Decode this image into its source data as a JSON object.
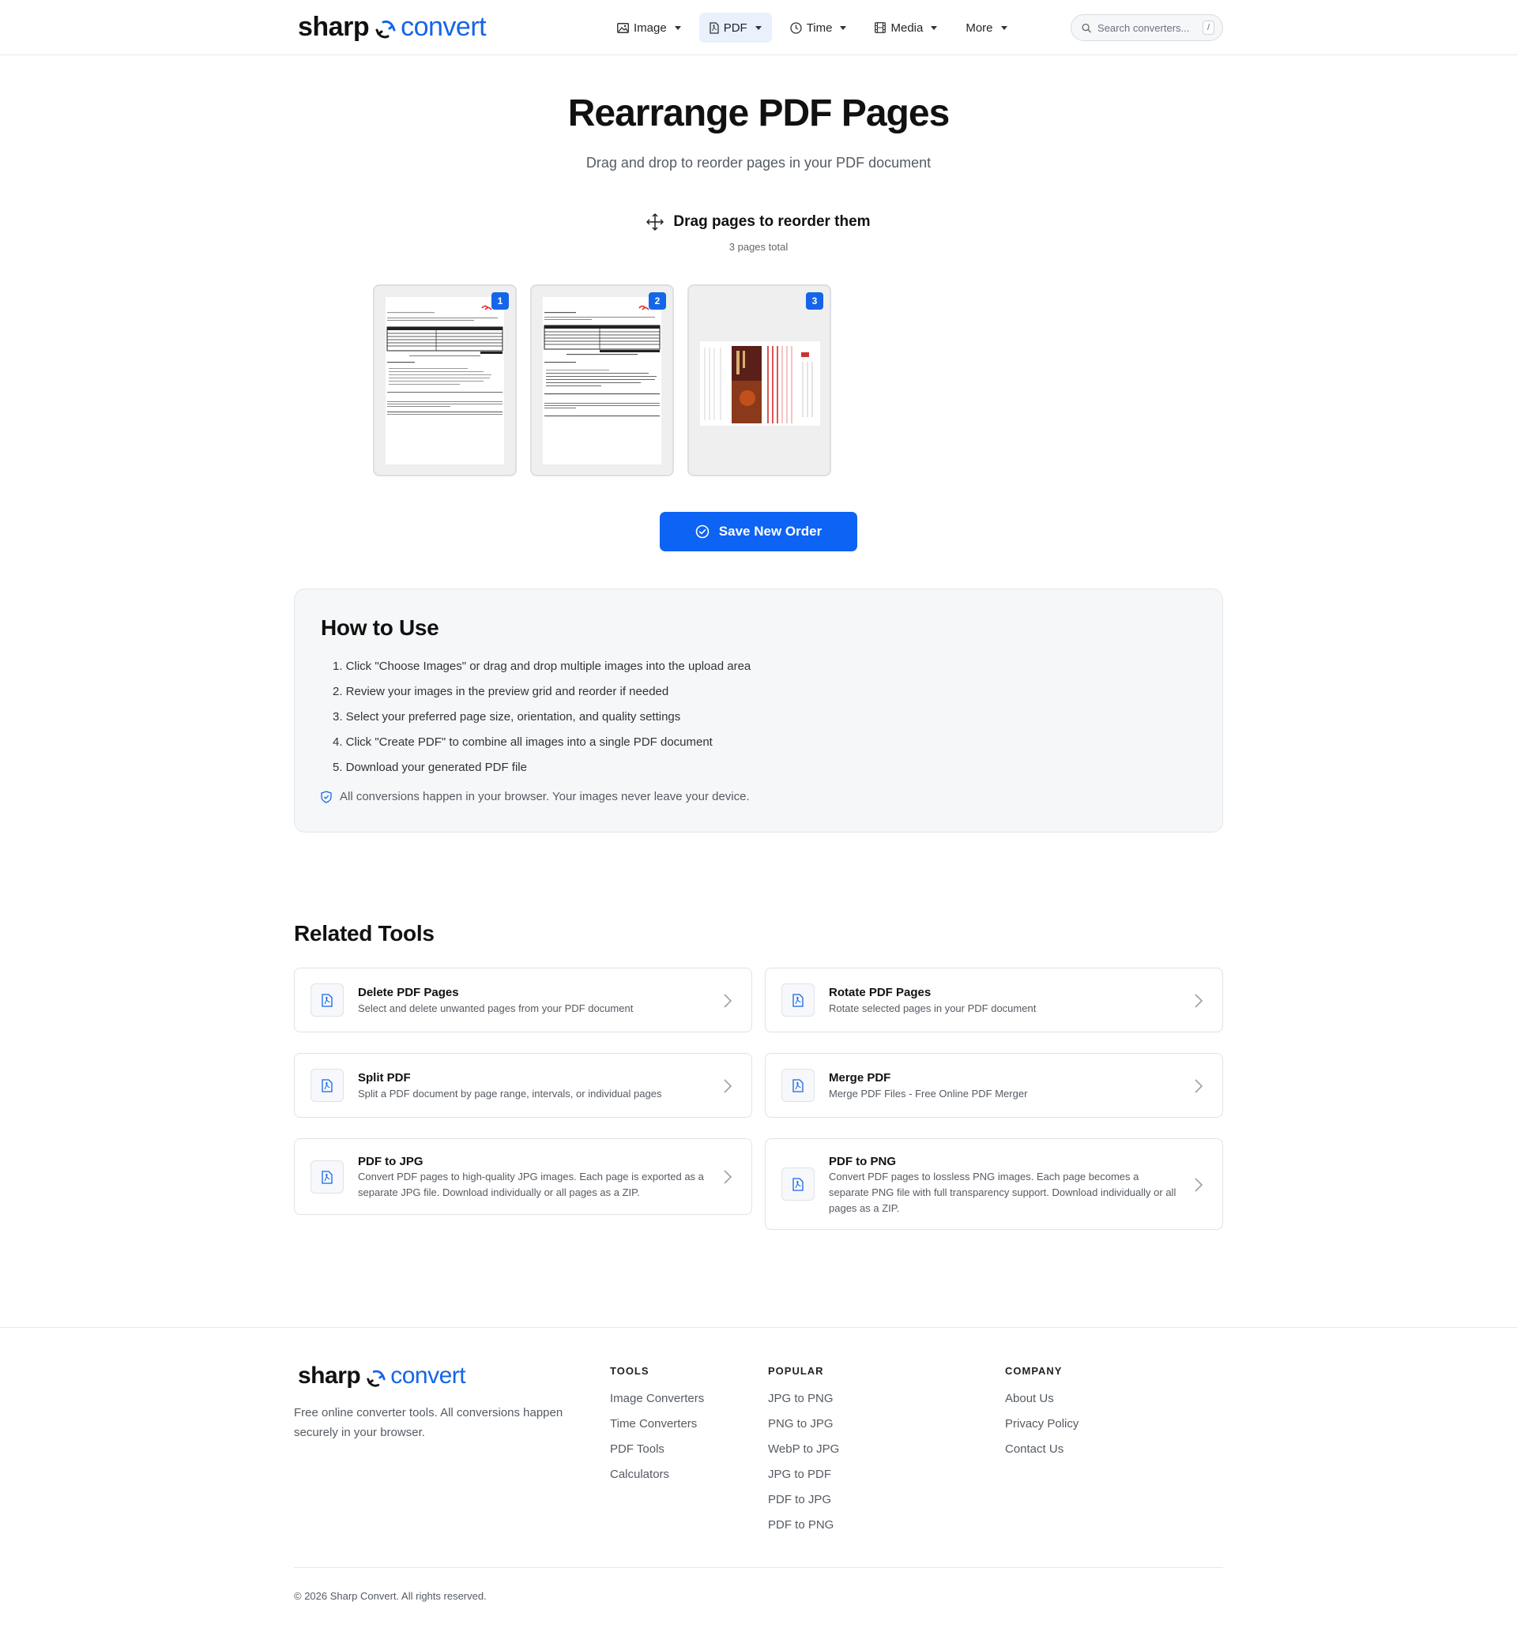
{
  "brand": {
    "name_part1": "sharp",
    "name_part2": "convert",
    "accent": "#1565e8"
  },
  "nav": {
    "items": [
      {
        "label": "Image",
        "icon": "image-icon"
      },
      {
        "label": "PDF",
        "icon": "pdf-icon",
        "active": true
      },
      {
        "label": "Time",
        "icon": "clock-icon"
      },
      {
        "label": "Media",
        "icon": "film-icon"
      },
      {
        "label": "More"
      }
    ]
  },
  "search": {
    "placeholder": "Search converters...",
    "shortcut": "/"
  },
  "hero": {
    "title": "Rearrange PDF Pages",
    "subtitle": "Drag and drop to reorder pages in your PDF document"
  },
  "editor": {
    "heading": "Drag pages to reorder them",
    "pages_total": "3 pages total",
    "pages": [
      {
        "number": "1",
        "kind": "document"
      },
      {
        "number": "2",
        "kind": "document"
      },
      {
        "number": "3",
        "kind": "brochure"
      }
    ],
    "save_label": "Save New Order"
  },
  "howto": {
    "title": "How to Use",
    "steps": [
      "1. Click \"Choose Images\" or drag and drop multiple images into the upload area",
      "2. Review your images in the preview grid and reorder if needed",
      "3. Select your preferred page size, orientation, and quality settings",
      "4. Click \"Create PDF\" to combine all images into a single PDF document",
      "5. Download your generated PDF file"
    ],
    "privacy_note": "All conversions happen in your browser. Your images never leave your device."
  },
  "related": {
    "title": "Related Tools",
    "tools": [
      {
        "name": "Delete PDF Pages",
        "description": "Select and delete unwanted pages from your PDF document"
      },
      {
        "name": "Rotate PDF Pages",
        "description": "Rotate selected pages in your PDF document"
      },
      {
        "name": "Split PDF",
        "description": "Split a PDF document by page range, intervals, or individual pages"
      },
      {
        "name": "Merge PDF",
        "description": "Merge PDF Files - Free Online PDF Merger"
      },
      {
        "name": "PDF to JPG",
        "description": "Convert PDF pages to high-quality JPG images. Each page is exported as a separate JPG file. Download individually or all pages as a ZIP."
      },
      {
        "name": "PDF to PNG",
        "description": "Convert PDF pages to lossless PNG images. Each page becomes a separate PNG file with full transparency support. Download individually or all pages as a ZIP."
      }
    ]
  },
  "footer": {
    "description": "Free online converter tools. All conversions happen securely in your browser.",
    "columns": [
      {
        "title": "TOOLS",
        "links": [
          "Image Converters",
          "Time Converters",
          "PDF Tools",
          "Calculators"
        ]
      },
      {
        "title": "POPULAR",
        "links": [
          "JPG to PNG",
          "PNG to JPG",
          "WebP to JPG",
          "JPG to PDF",
          "PDF to JPG",
          "PDF to PNG"
        ]
      },
      {
        "title": "COMPANY",
        "links": [
          "About Us",
          "Privacy Policy",
          "Contact Us"
        ]
      }
    ],
    "copyright": "© 2026 Sharp Convert. All rights reserved."
  }
}
